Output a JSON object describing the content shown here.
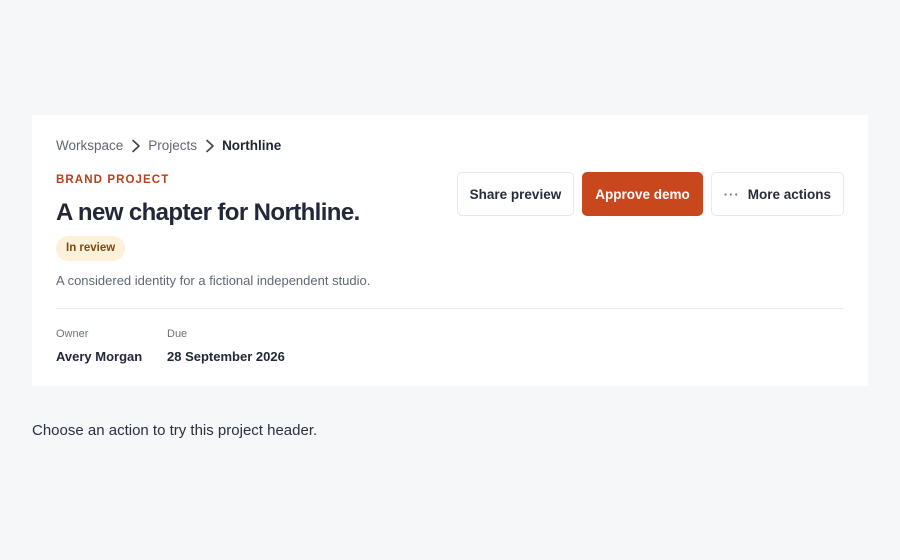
{
  "breadcrumb": {
    "items": [
      "Workspace",
      "Projects"
    ],
    "current": "Northline"
  },
  "project": {
    "eyebrow": "BRAND PROJECT",
    "title": "A new chapter for Northline.",
    "status": "In review",
    "description": "A considered identity for a fictional independent studio.",
    "owner_label": "Owner",
    "owner": "Avery Morgan",
    "due_label": "Due",
    "due": "28 September 2026"
  },
  "actions": {
    "share_label": "Share preview",
    "approve_label": "Approve demo",
    "more_label": "More actions"
  },
  "hint": "Choose an action to try this project header.",
  "colors": {
    "accent": "#c9471c",
    "eyebrow": "#b8401a",
    "badge_bg": "#fdf1dc",
    "badge_text": "#7a4b10"
  },
  "icons": {
    "breadcrumb_separator": "chevron-right-icon",
    "more": "more-horizontal-icon"
  }
}
